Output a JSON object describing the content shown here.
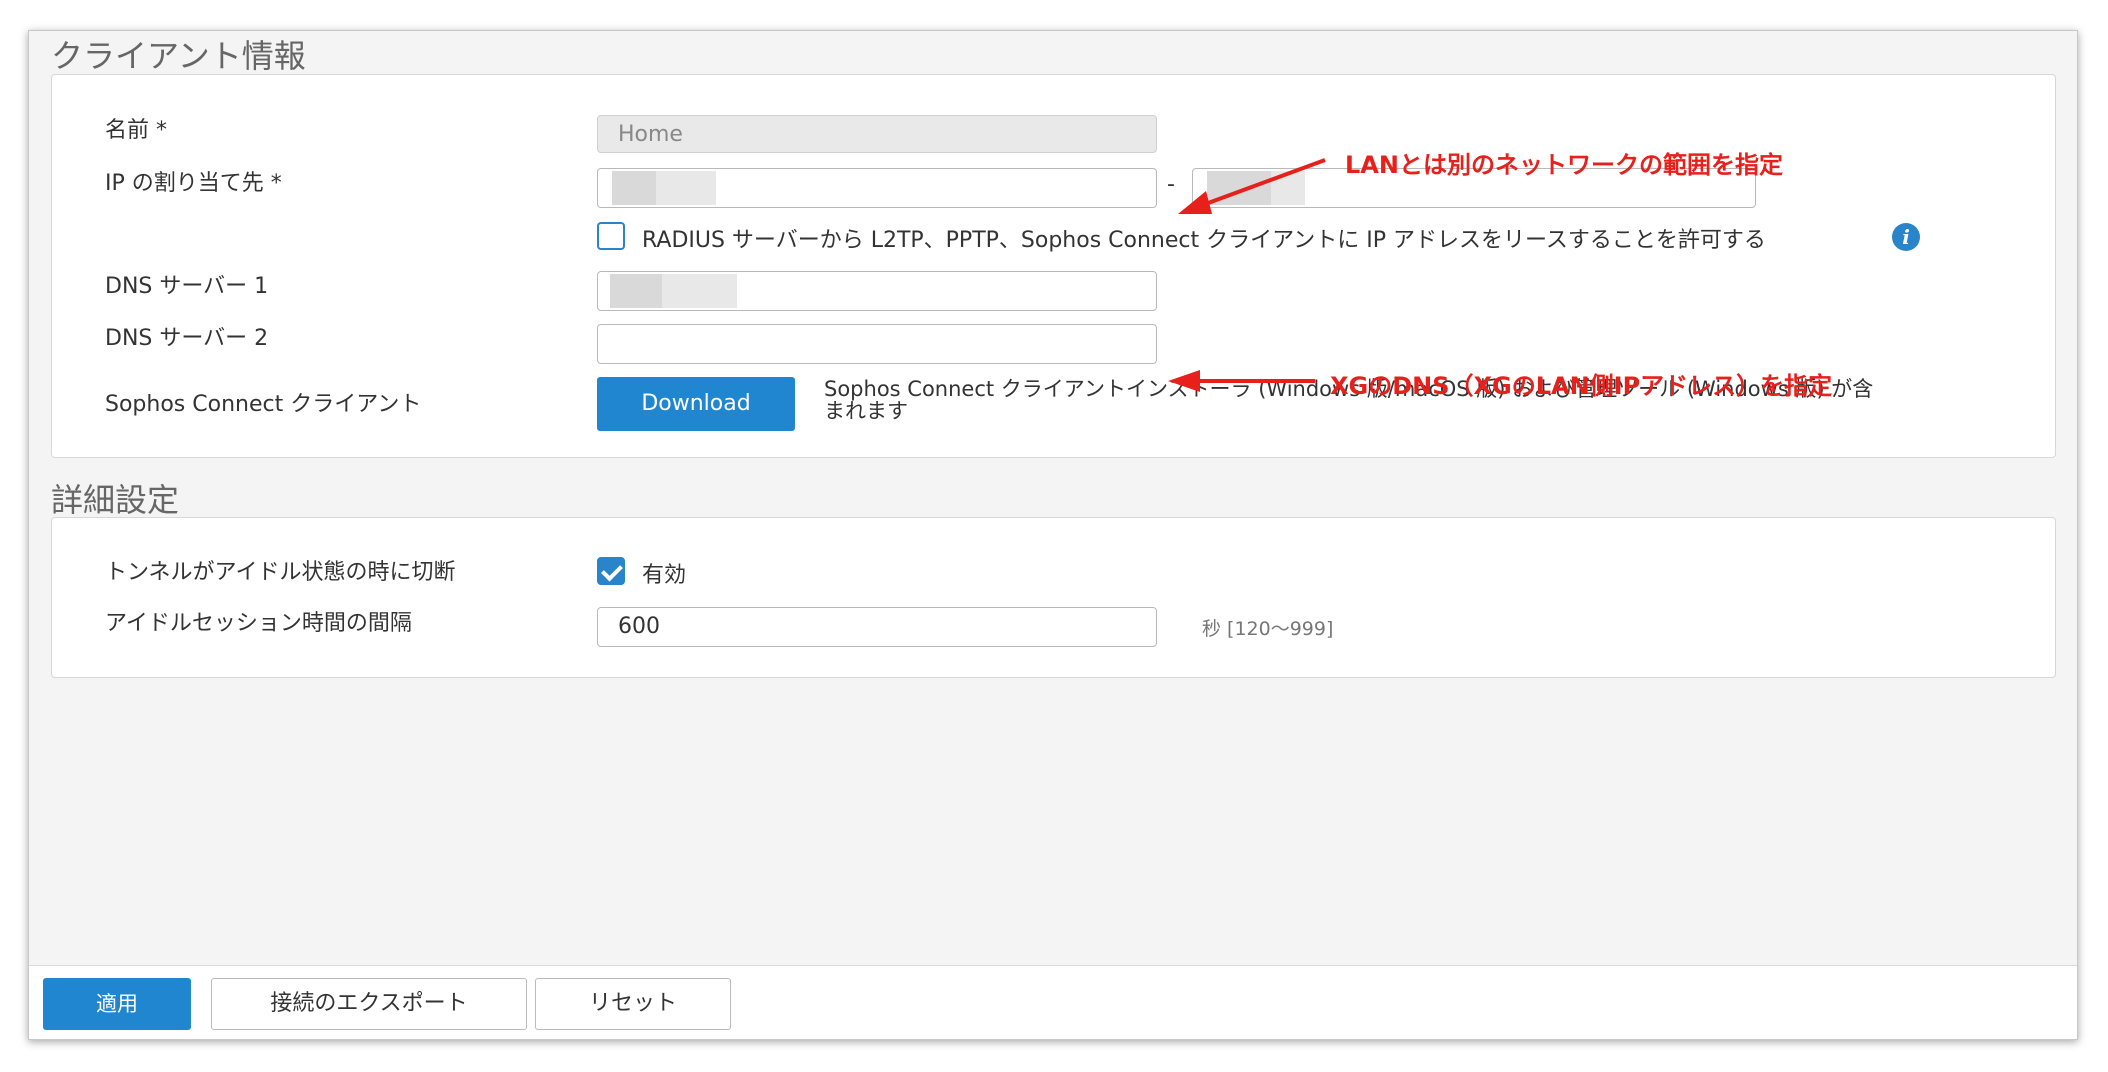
{
  "client_info": {
    "title": "クライアント情報",
    "name_label": "名前 *",
    "name_value": "Home",
    "ip_label": "IP の割り当て先 *",
    "ip_separator": "-",
    "radius_label": "RADIUS サーバーから L2TP、PPTP、Sophos Connect クライアントに IP アドレスをリースすることを許可する",
    "radius_checked": false,
    "dns1_label": "DNS サーバー 1",
    "dns2_label": "DNS サーバー 2",
    "sophos_label": "Sophos Connect クライアント",
    "download_label": "Download",
    "download_desc_line1": "Sophos Connect クライアントインストーラ (Windows 版/macOS 版) および管理ツール (Windows 版) が含",
    "download_desc_line2": "まれます"
  },
  "advanced": {
    "title": "詳細設定",
    "idle_disconnect_label": "トンネルがアイドル状態の時に切断",
    "idle_enabled_label": "有効",
    "idle_enabled": true,
    "idle_interval_label": "アイドルセッション時間の間隔",
    "idle_interval_value": "600",
    "idle_interval_hint": "秒 [120〜999]"
  },
  "footer": {
    "apply_label": "適用",
    "export_label": "接続のエクスポート",
    "reset_label": "リセット"
  },
  "annotations": {
    "ip_note": "LANとは別のネットワークの範囲を指定",
    "dns_note": "XGのDNS（XGのLAN側IPアドレス）を指定"
  },
  "colors": {
    "accent": "#1f86cf",
    "annotation": "#e8201c"
  }
}
